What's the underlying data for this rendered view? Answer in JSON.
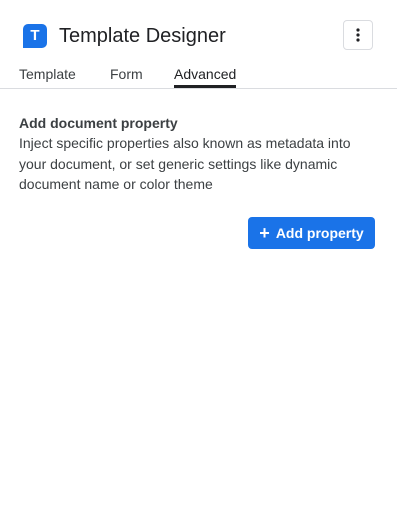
{
  "header": {
    "logo_letter": "T",
    "title": "Template Designer",
    "menu_icon": "more-vertical-icon"
  },
  "tabs": [
    {
      "label": "Template",
      "active": false
    },
    {
      "label": "Form",
      "active": false
    },
    {
      "label": "Advanced",
      "active": true
    }
  ],
  "section": {
    "title": "Add document property",
    "description": "Inject specific properties also known as metadata into your document, or set generic settings like dynamic document name or color theme"
  },
  "actions": {
    "add_property_label": "Add property",
    "add_icon": "plus-icon"
  },
  "colors": {
    "accent": "#1a73e8",
    "text": "#202124",
    "divider": "#dadce0"
  }
}
